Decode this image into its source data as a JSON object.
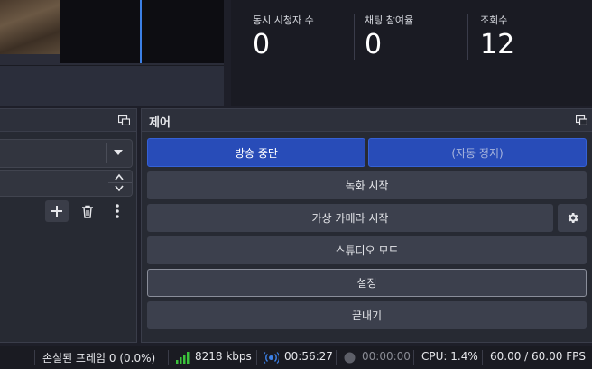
{
  "stats": {
    "items": [
      {
        "label": "동시 시청자 수",
        "value": "0"
      },
      {
        "label": "채팅 참여율",
        "value": "0"
      },
      {
        "label": "조회수",
        "value": "12"
      }
    ]
  },
  "controls": {
    "title": "제어",
    "stop_stream": "방송 중단",
    "auto_stop": "(자동 정지)",
    "start_recording": "녹화 시작",
    "start_virtual_camera": "가상 카메라 시작",
    "studio_mode": "스튜디오 모드",
    "settings": "설정",
    "exit": "끝내기"
  },
  "status": {
    "dropped_frames": "손실된 프레임 0 (0.0%)",
    "bitrate": "8218 kbps",
    "stream_time": "00:56:27",
    "record_time": "00:00:00",
    "cpu": "CPU: 1.4%",
    "fps": "60.00 / 60.00 FPS"
  },
  "colors": {
    "accent_blue": "#284cb8",
    "signal_green": "#3bc23b",
    "stream_blue": "#3c80e6"
  }
}
